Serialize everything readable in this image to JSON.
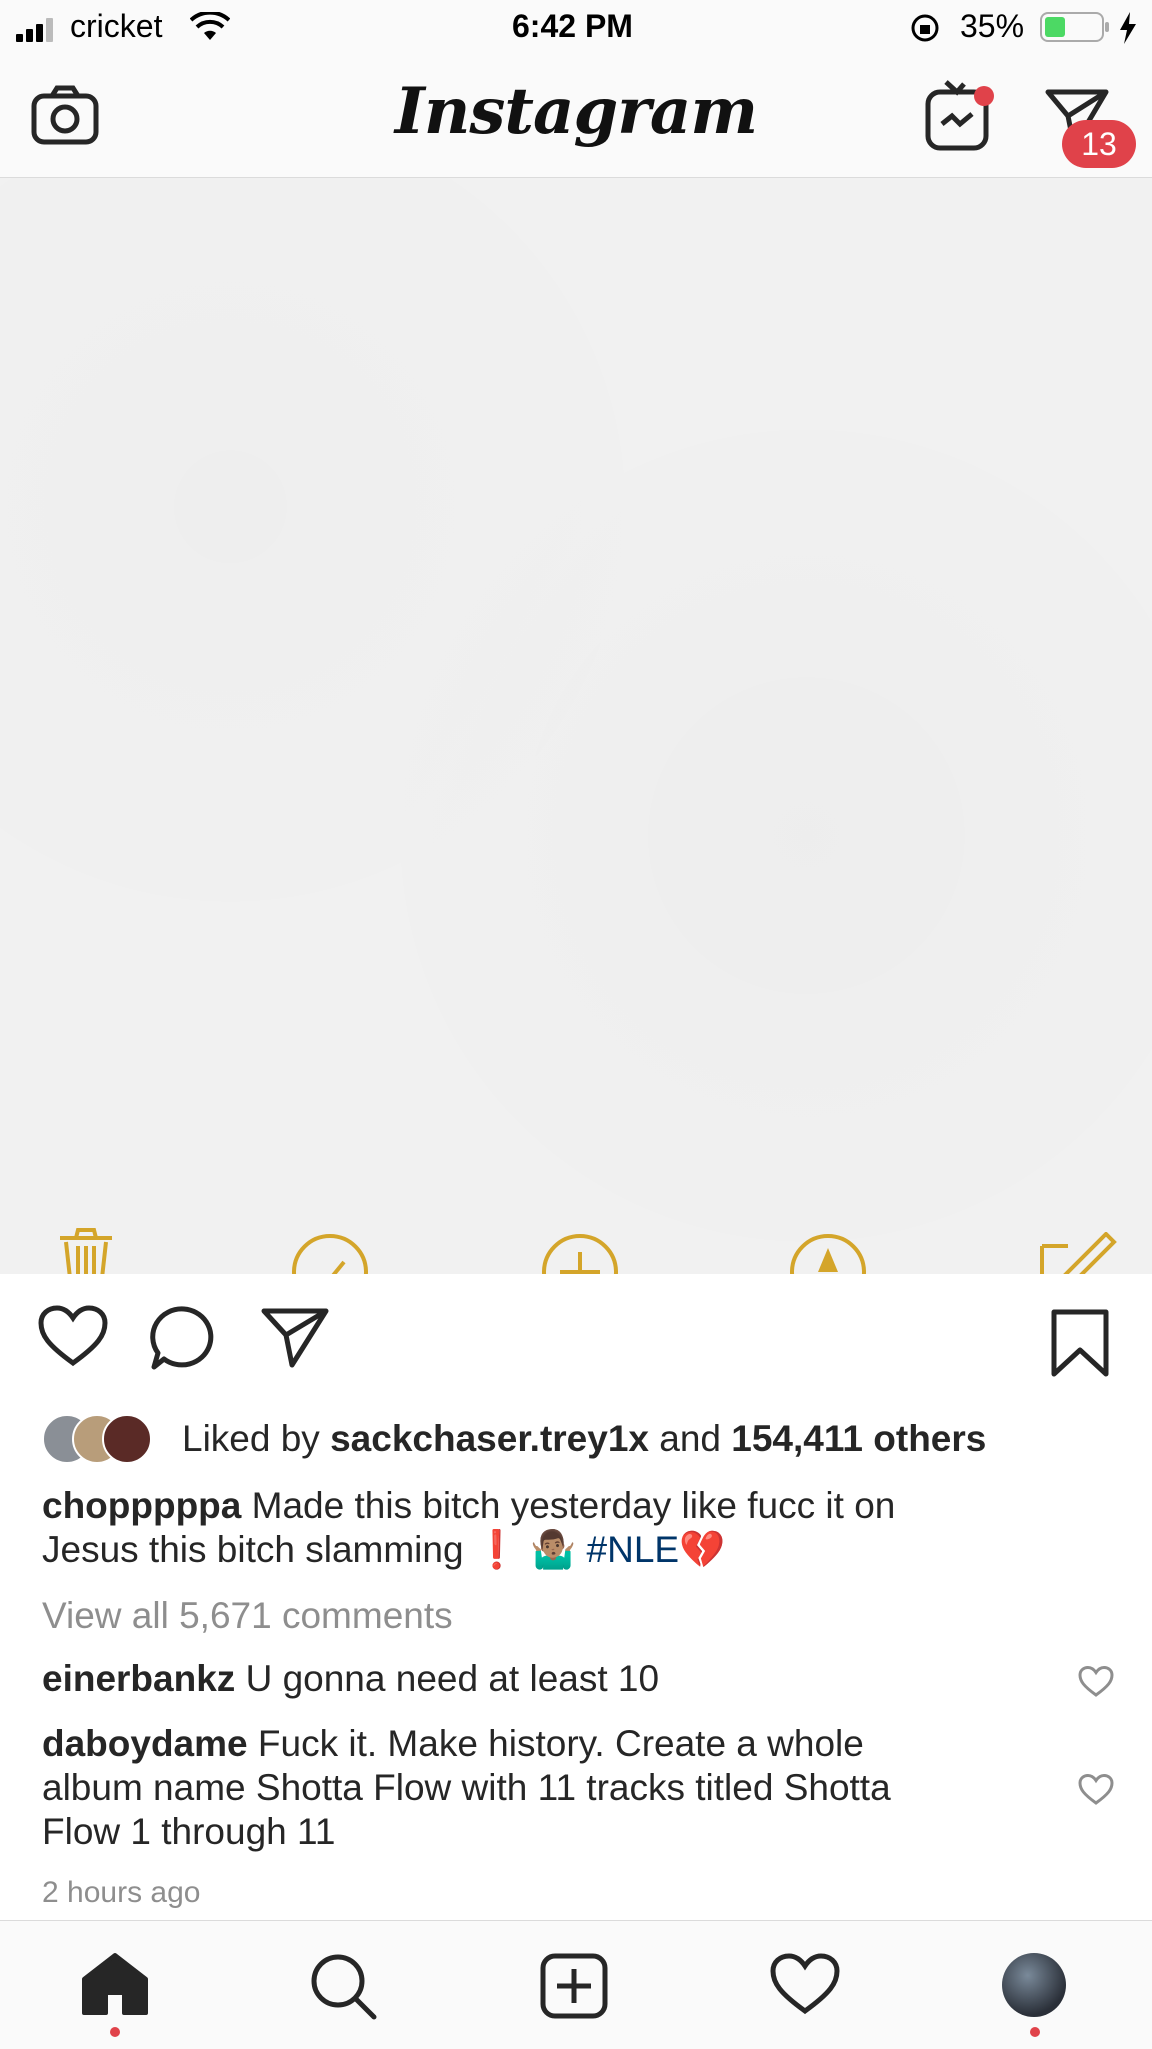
{
  "status_bar": {
    "carrier": "cricket",
    "time": "6:42 PM",
    "battery": "35%"
  },
  "header": {
    "logo": "Instagram",
    "direct_badge": "13"
  },
  "colors": {
    "badge": "#e0424a",
    "hashtag": "#003569",
    "notes_icon": "#d4a52a"
  },
  "post": {
    "likes": {
      "prefix": "Liked by",
      "user": "sackchaser.trey1x",
      "joiner": "and",
      "others": "154,411 others"
    },
    "caption": {
      "user": "chopppppa",
      "line1": "Made this bitch yesterday like fucc it on",
      "line2_text": "Jesus this bitch slamming",
      "line2_emoji": "❗️ 🤷🏽‍♂️",
      "hashtag": "#NLE",
      "end_emoji": "💔"
    },
    "view_comments": "View all 5,671 comments",
    "comments": [
      {
        "user": "einerbankz",
        "text": "U gonna need at least 10"
      },
      {
        "user": "daboydame",
        "line1": "Fuck it. Make history. Create a whole",
        "line2": "album name Shotta Flow with 11 tracks titled Shotta",
        "line3": "Flow 1 through 11"
      }
    ],
    "timestamp": "2 hours ago"
  },
  "icons": [
    "camera-icon",
    "igtv-icon",
    "direct-icon",
    "trash-icon",
    "check-icon",
    "plus-circle-icon",
    "compass-icon",
    "compose-icon",
    "heart-icon",
    "comment-icon",
    "share-icon",
    "bookmark-icon",
    "home-icon",
    "search-icon",
    "new-post-icon",
    "activity-icon",
    "profile-avatar"
  ]
}
